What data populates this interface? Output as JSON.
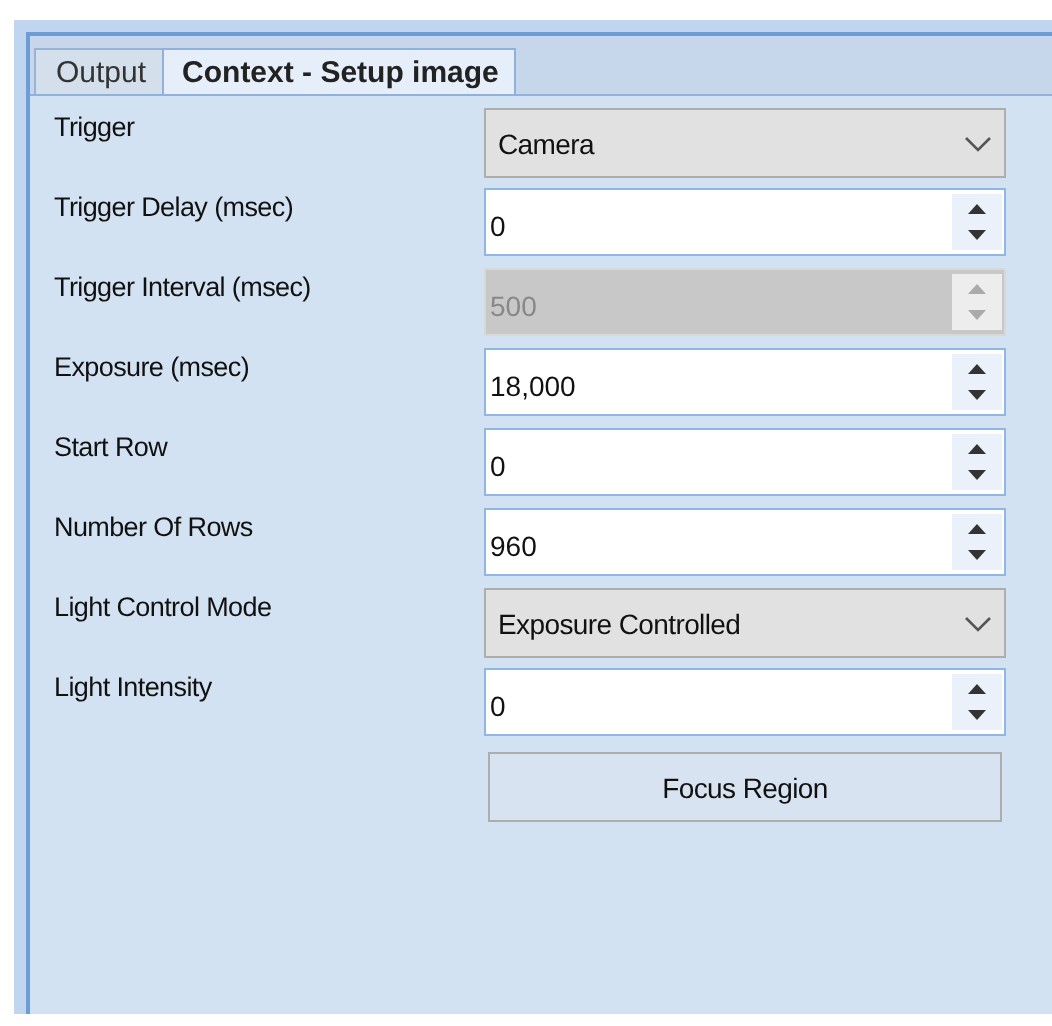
{
  "tabs": [
    {
      "label": "Output",
      "selected": false
    },
    {
      "label": "Context - Setup image",
      "selected": true
    }
  ],
  "fields": [
    {
      "kind": "dropdown",
      "label": "Trigger",
      "value": "Camera"
    },
    {
      "kind": "spinner",
      "label": "Trigger Delay (msec)",
      "value": "0",
      "disabled": false
    },
    {
      "kind": "spinner",
      "label": "Trigger Interval (msec)",
      "value": "500",
      "disabled": true
    },
    {
      "kind": "spinner",
      "label": "Exposure (msec)",
      "value": "18,000",
      "disabled": false
    },
    {
      "kind": "spinner",
      "label": "Start Row",
      "value": "0",
      "disabled": false
    },
    {
      "kind": "spinner",
      "label": "Number Of Rows",
      "value": "960",
      "disabled": false
    },
    {
      "kind": "dropdown",
      "label": "Light Control Mode",
      "value": "Exposure Controlled"
    },
    {
      "kind": "spinner",
      "label": "Light Intensity",
      "value": "0",
      "disabled": false
    },
    {
      "kind": "button",
      "label": "Focus Region"
    }
  ]
}
